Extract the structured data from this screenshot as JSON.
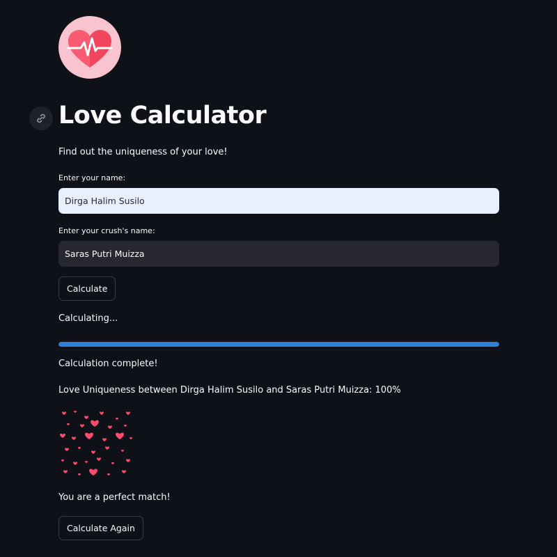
{
  "app": {
    "title": "Love Calculator",
    "subtitle": "Find out the uniqueness of your love!"
  },
  "form": {
    "name_label": "Enter your name:",
    "name_value": "Dirga Halim Susilo",
    "crush_label": "Enter your crush's name:",
    "crush_value": "Saras Putri Muizza",
    "calculate_label": "Calculate"
  },
  "status": {
    "calculating": "Calculating...",
    "progress_percent": 100,
    "complete": "Calculation complete!",
    "result": "Love Uniqueness between Dirga Halim Susilo and Saras Putri Muizza: 100%",
    "message": "You are a perfect match!"
  },
  "actions": {
    "again_label": "Calculate Again"
  },
  "colors": {
    "background": "#0e1117",
    "accent": "#2e7fd6",
    "heart": "#ff4b6e"
  },
  "icons": {
    "logo": "heart-pulse-icon",
    "anchor": "link-icon",
    "hearts_image": "hearts-pattern"
  }
}
